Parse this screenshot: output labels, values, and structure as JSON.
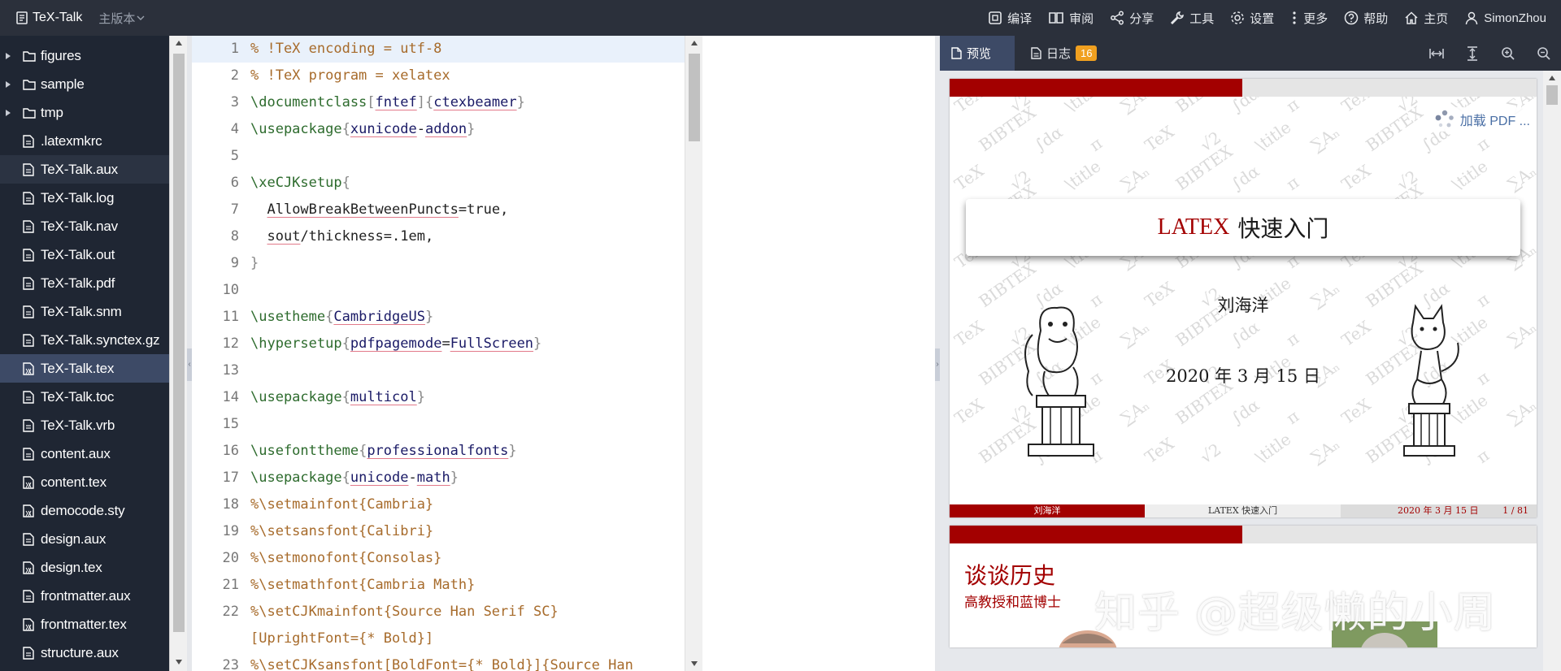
{
  "topbar": {
    "app_name": "TeX-Talk",
    "version_label": "主版本",
    "menu": [
      {
        "label": "编译",
        "icon": "compile-icon"
      },
      {
        "label": "审阅",
        "icon": "review-icon"
      },
      {
        "label": "分享",
        "icon": "share-icon"
      },
      {
        "label": "工具",
        "icon": "tools-icon"
      },
      {
        "label": "设置",
        "icon": "gear-icon"
      },
      {
        "label": "更多",
        "icon": "more-icon"
      },
      {
        "label": "帮助",
        "icon": "help-icon"
      },
      {
        "label": "主页",
        "icon": "home-icon"
      },
      {
        "label": "SimonZhou",
        "icon": "user-icon"
      }
    ]
  },
  "filetree": {
    "items": [
      {
        "label": "figures",
        "type": "folder"
      },
      {
        "label": "sample",
        "type": "folder"
      },
      {
        "label": "tmp",
        "type": "folder"
      },
      {
        "label": ".latexmkrc",
        "type": "file"
      },
      {
        "label": "TeX-Talk.aux",
        "type": "file"
      },
      {
        "label": "TeX-Talk.log",
        "type": "file"
      },
      {
        "label": "TeX-Talk.nav",
        "type": "file"
      },
      {
        "label": "TeX-Talk.out",
        "type": "file"
      },
      {
        "label": "TeX-Talk.pdf",
        "type": "file"
      },
      {
        "label": "TeX-Talk.snm",
        "type": "file"
      },
      {
        "label": "TeX-Talk.synctex.gz",
        "type": "file"
      },
      {
        "label": "TeX-Talk.tex",
        "type": "tex"
      },
      {
        "label": "TeX-Talk.toc",
        "type": "file"
      },
      {
        "label": "TeX-Talk.vrb",
        "type": "file"
      },
      {
        "label": "content.aux",
        "type": "file"
      },
      {
        "label": "content.tex",
        "type": "tex"
      },
      {
        "label": "democode.sty",
        "type": "tex"
      },
      {
        "label": "design.aux",
        "type": "file"
      },
      {
        "label": "design.tex",
        "type": "tex"
      },
      {
        "label": "frontmatter.aux",
        "type": "file"
      },
      {
        "label": "frontmatter.tex",
        "type": "tex"
      },
      {
        "label": "structure.aux",
        "type": "file"
      }
    ],
    "hovered": "TeX-Talk.aux",
    "selected": "TeX-Talk.tex"
  },
  "editor": {
    "lines": [
      {
        "n": "1",
        "segs": [
          [
            "cmt",
            "% !TeX encoding = utf-8"
          ]
        ]
      },
      {
        "n": "2",
        "segs": [
          [
            "cmt",
            "% !TeX program = xelatex"
          ]
        ]
      },
      {
        "n": "3",
        "segs": [
          [
            "cmd",
            "\\documentclass"
          ],
          [
            "brc",
            "["
          ],
          [
            "arg",
            "fntef"
          ],
          [
            "brc",
            "]{"
          ],
          [
            "arg",
            "ctexbeamer"
          ],
          [
            "brc",
            "}"
          ]
        ]
      },
      {
        "n": "4",
        "segs": [
          [
            "cmd",
            "\\usepackage"
          ],
          [
            "brc",
            "{"
          ],
          [
            "arg",
            "xunicode"
          ],
          [
            "txt",
            "-"
          ],
          [
            "arg",
            "addon"
          ],
          [
            "brc",
            "}"
          ]
        ]
      },
      {
        "n": "5",
        "segs": []
      },
      {
        "n": "6",
        "segs": [
          [
            "cmd",
            "\\xeCJKsetup"
          ],
          [
            "brc",
            "{"
          ]
        ]
      },
      {
        "n": "7",
        "segs": [
          [
            "txt",
            "  "
          ],
          [
            "tu",
            "AllowBreakBetweenPuncts"
          ],
          [
            "txt",
            "=true,"
          ]
        ]
      },
      {
        "n": "8",
        "segs": [
          [
            "txt",
            "  "
          ],
          [
            "tu",
            "sout"
          ],
          [
            "txt",
            "/thickness=.1em,"
          ]
        ]
      },
      {
        "n": "9",
        "segs": [
          [
            "brc",
            "}"
          ]
        ]
      },
      {
        "n": "10",
        "segs": []
      },
      {
        "n": "11",
        "segs": [
          [
            "cmd",
            "\\usetheme"
          ],
          [
            "brc",
            "{"
          ],
          [
            "arg",
            "CambridgeUS"
          ],
          [
            "brc",
            "}"
          ]
        ]
      },
      {
        "n": "12",
        "segs": [
          [
            "cmd",
            "\\hypersetup"
          ],
          [
            "brc",
            "{"
          ],
          [
            "arg",
            "pdfpagemode"
          ],
          [
            "txt",
            "="
          ],
          [
            "arg",
            "FullScreen"
          ],
          [
            "brc",
            "}"
          ]
        ]
      },
      {
        "n": "13",
        "segs": []
      },
      {
        "n": "14",
        "segs": [
          [
            "cmd",
            "\\usepackage"
          ],
          [
            "brc",
            "{"
          ],
          [
            "arg",
            "multicol"
          ],
          [
            "brc",
            "}"
          ]
        ]
      },
      {
        "n": "15",
        "segs": []
      },
      {
        "n": "16",
        "segs": [
          [
            "cmd",
            "\\usefonttheme"
          ],
          [
            "brc",
            "{"
          ],
          [
            "arg",
            "professionalfonts"
          ],
          [
            "brc",
            "}"
          ]
        ]
      },
      {
        "n": "17",
        "segs": [
          [
            "cmd",
            "\\usepackage"
          ],
          [
            "brc",
            "{"
          ],
          [
            "arg",
            "unicode"
          ],
          [
            "txt",
            "-"
          ],
          [
            "arg",
            "math"
          ],
          [
            "brc",
            "}"
          ]
        ]
      },
      {
        "n": "18",
        "segs": [
          [
            "cmt",
            "%\\setmainfont{Cambria}"
          ]
        ]
      },
      {
        "n": "19",
        "segs": [
          [
            "cmt",
            "%\\setsansfont{Calibri}"
          ]
        ]
      },
      {
        "n": "20",
        "segs": [
          [
            "cmt",
            "%\\setmonofont{Consolas}"
          ]
        ]
      },
      {
        "n": "21",
        "segs": [
          [
            "cmt",
            "%\\setmathfont{Cambria Math}"
          ]
        ]
      },
      {
        "n": "22",
        "segs": [
          [
            "cmt",
            "%\\setCJKmainfont{Source Han Serif SC}"
          ]
        ]
      },
      {
        "n": "",
        "segs": [
          [
            "cmt",
            "[UprightFont={* Bold}]"
          ]
        ]
      },
      {
        "n": "23",
        "segs": [
          [
            "cmt",
            "%\\setCJKsansfont[BoldFont={* Bold}]{Source Han"
          ]
        ]
      }
    ]
  },
  "preview": {
    "tab_preview": "预览",
    "tab_log": "日志",
    "log_count": "16",
    "loading_text": "加载 PDF ...",
    "slide1": {
      "title_logo": "LATEX",
      "title": "快速入门",
      "author": "刘海洋",
      "date": "2020 年 3 月 15 日",
      "footer_author": "刘海洋",
      "footer_title": "LATEX 快速入门",
      "footer_date": "2020 年 3 月 15 日",
      "footer_page": "1 / 81"
    },
    "slide2": {
      "heading": "谈谈历史",
      "subheading": "高教授和蓝博士"
    }
  },
  "watermark": "知乎 @超级懒的小周",
  "colors": {
    "accent_red": "#a30000",
    "topbar": "#2b303b",
    "sidebar": "#1f2633",
    "selected": "#3d4a66",
    "badge": "#f0a020"
  }
}
